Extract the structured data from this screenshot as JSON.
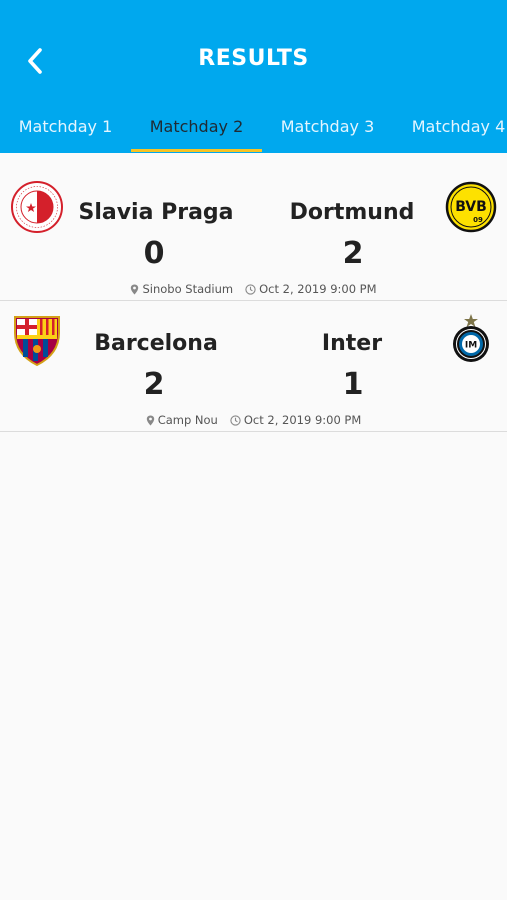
{
  "header": {
    "title": "RESULTS",
    "back_icon": "chevron-left-icon"
  },
  "tabs": [
    {
      "label": "Matchday 1",
      "active": false
    },
    {
      "label": "Matchday 2",
      "active": true
    },
    {
      "label": "Matchday 3",
      "active": false
    },
    {
      "label": "Matchday 4",
      "active": false
    }
  ],
  "colors": {
    "header_bg": "#00a8ee",
    "tab_indicator": "#f7c325",
    "page_bg": "#fafafa"
  },
  "matches": [
    {
      "home": {
        "name": "Slavia Praga",
        "score": "0",
        "crest": "slavia-praha-crest"
      },
      "away": {
        "name": "Dortmund",
        "score": "2",
        "crest": "bvb-crest"
      },
      "venue": "Sinobo Stadium",
      "datetime": "Oct 2, 2019 9:00 PM"
    },
    {
      "home": {
        "name": "Barcelona",
        "score": "2",
        "crest": "fc-barcelona-crest"
      },
      "away": {
        "name": "Inter",
        "score": "1",
        "crest": "inter-crest"
      },
      "venue": "Camp Nou",
      "datetime": "Oct 2, 2019 9:00 PM"
    }
  ]
}
